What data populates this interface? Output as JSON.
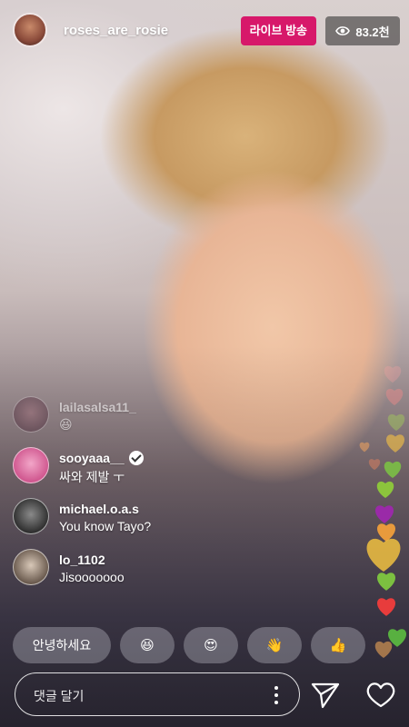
{
  "header": {
    "username": "roses_are_rosie",
    "live_label": "라이브 방송",
    "viewer_count": "83.2천"
  },
  "comments": [
    {
      "username": "lailasalsa11_",
      "text": "😆",
      "verified": false,
      "faded": true
    },
    {
      "username": "sooyaaa__",
      "text": "싸와 제발 ㅜ",
      "verified": true,
      "faded": false
    },
    {
      "username": "michael.o.a.s",
      "text": "You know Tayo?",
      "verified": false,
      "faded": false
    },
    {
      "username": "lo_1102",
      "text": "Jisooooooo",
      "verified": false,
      "faded": false
    }
  ],
  "quick_reactions": {
    "text_chip": "안녕하세요",
    "emoji_chips": [
      "😆",
      "😍",
      "👋",
      "👍"
    ]
  },
  "comment_input": {
    "placeholder": "댓글 달기"
  },
  "icons": {
    "more": "more-vertical-icon",
    "send": "send-icon",
    "like": "heart-icon",
    "viewers": "eye-icon"
  },
  "colors": {
    "live_badge": "#d7186a",
    "viewer_badge": "#3a3a3a"
  }
}
